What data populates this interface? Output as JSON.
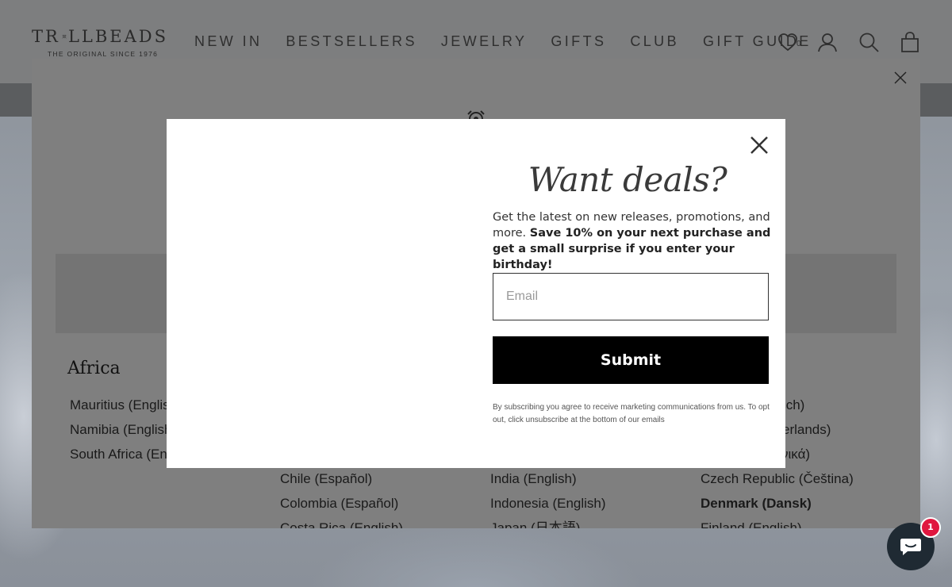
{
  "brand": {
    "name_left": "TR",
    "name_right": "LLBEADS",
    "tagline": "THE ORIGINAL SINCE 1976"
  },
  "nav": {
    "items": [
      "NEW IN",
      "BESTSELLERS",
      "JEWELRY",
      "GIFTS",
      "CLUB",
      "GIFT GUIDE"
    ],
    "wishlist_count": "0",
    "icons": [
      "heart-icon",
      "account-icon",
      "search-icon",
      "cart-icon"
    ]
  },
  "region_selector": {
    "columns": [
      {
        "heading": "Africa",
        "countries": [
          "Mauritius (English)",
          "Namibia (English)",
          "South Africa (English)"
        ]
      },
      {
        "heading": "",
        "countries": [
          "Chile (Español)",
          "Colombia (Español)",
          "Costa Rica (English)"
        ]
      },
      {
        "heading": "",
        "countries": [
          "India (English)",
          "Indonesia (English)",
          "Japan (日本語)"
        ]
      },
      {
        "heading": "",
        "countries": [
          "Austria (Deutsch)",
          "Belgium (Nederlands)",
          "Cyprus (Ελληνικά)",
          "Czech Republic (Čeština)",
          "Denmark (Dansk)",
          "Finland (English)"
        ],
        "bold_index": 4
      }
    ]
  },
  "popup": {
    "title": "Want deals?",
    "text_plain": "Get the latest on new releases, promotions, and more. ",
    "text_bold": "Save 10% on your next purchase and get a small surprise if you enter your birthday!",
    "email_placeholder": "Email",
    "email_value": "",
    "submit_label": "Submit",
    "legal": "By subscribing you agree to receive marketing communications from us. To opt out, click unsubscribe at the bottom of our emails"
  },
  "chat": {
    "badge_count": "1"
  },
  "colors": {
    "overlay": "#7f7f7f",
    "button": "#000000",
    "chat": "#1f2a33",
    "badge": "#e0173f"
  }
}
